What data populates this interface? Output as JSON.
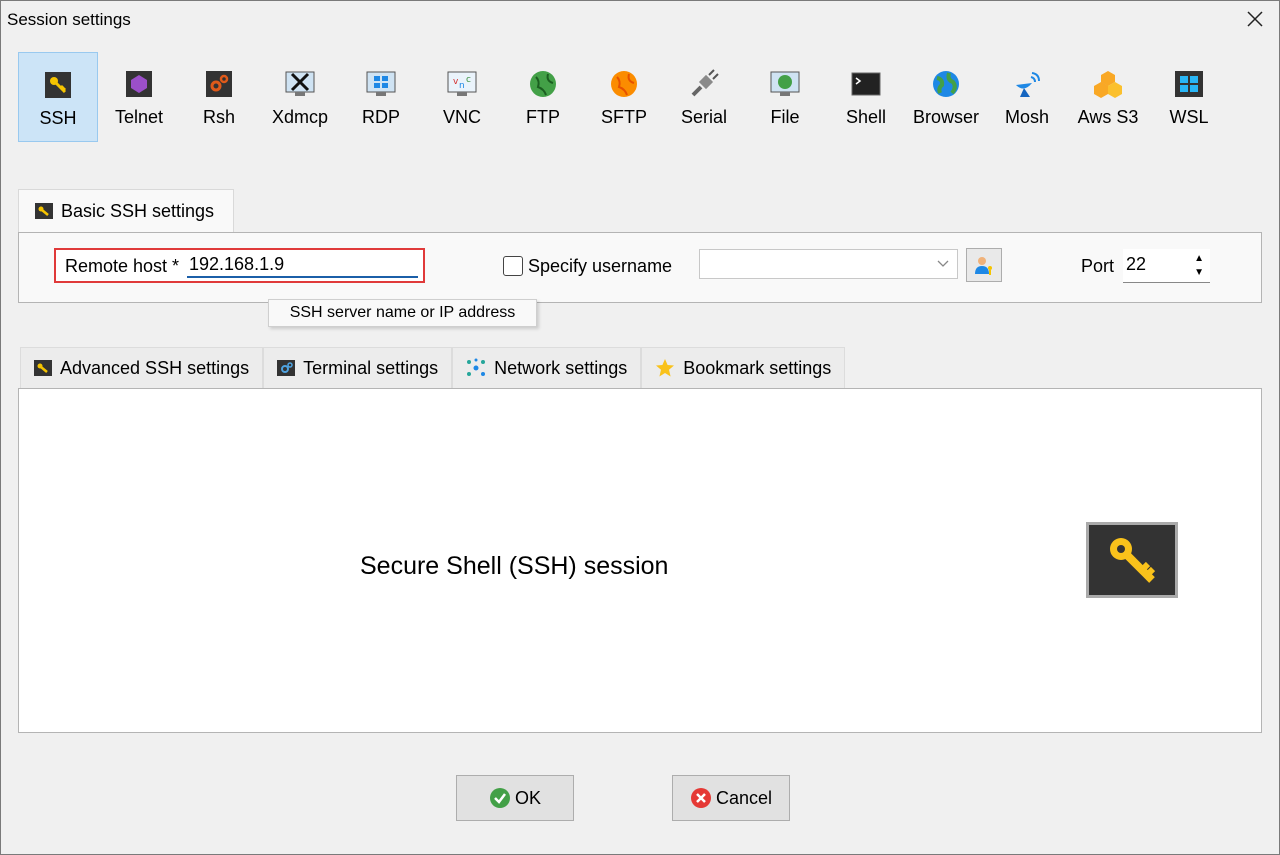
{
  "window": {
    "title": "Session settings"
  },
  "toolbar": {
    "items": [
      {
        "label": "SSH",
        "icon": "key-icon",
        "active": true
      },
      {
        "label": "Telnet",
        "icon": "telnet-icon"
      },
      {
        "label": "Rsh",
        "icon": "rsh-icon"
      },
      {
        "label": "Xdmcp",
        "icon": "xdmcp-icon"
      },
      {
        "label": "RDP",
        "icon": "rdp-icon"
      },
      {
        "label": "VNC",
        "icon": "vnc-icon"
      },
      {
        "label": "FTP",
        "icon": "ftp-globe-icon"
      },
      {
        "label": "SFTP",
        "icon": "sftp-globe-icon"
      },
      {
        "label": "Serial",
        "icon": "serial-plug-icon"
      },
      {
        "label": "File",
        "icon": "file-monitor-icon"
      },
      {
        "label": "Shell",
        "icon": "shell-terminal-icon"
      },
      {
        "label": "Browser",
        "icon": "browser-globe-icon"
      },
      {
        "label": "Mosh",
        "icon": "mosh-satellite-icon"
      },
      {
        "label": "Aws S3",
        "icon": "aws-s3-icon"
      },
      {
        "label": "WSL",
        "icon": "wsl-windows-icon"
      }
    ]
  },
  "basic": {
    "tab_label": "Basic SSH settings",
    "remote_host_label": "Remote host *",
    "remote_host_value": "192.168.1.9",
    "specify_username_label": "Specify username",
    "username_value": "",
    "port_label": "Port",
    "port_value": "22",
    "tooltip": "SSH server name or IP address"
  },
  "tabs": {
    "advanced": "Advanced SSH settings",
    "terminal": "Terminal settings",
    "network": "Network settings",
    "bookmark": "Bookmark settings"
  },
  "main": {
    "description": "Secure Shell (SSH) session"
  },
  "buttons": {
    "ok": "OK",
    "cancel": "Cancel"
  },
  "colors": {
    "accent": "#1b5fa8",
    "highlight_border": "#e03a3a",
    "active_tool_bg": "#cce4f7"
  }
}
